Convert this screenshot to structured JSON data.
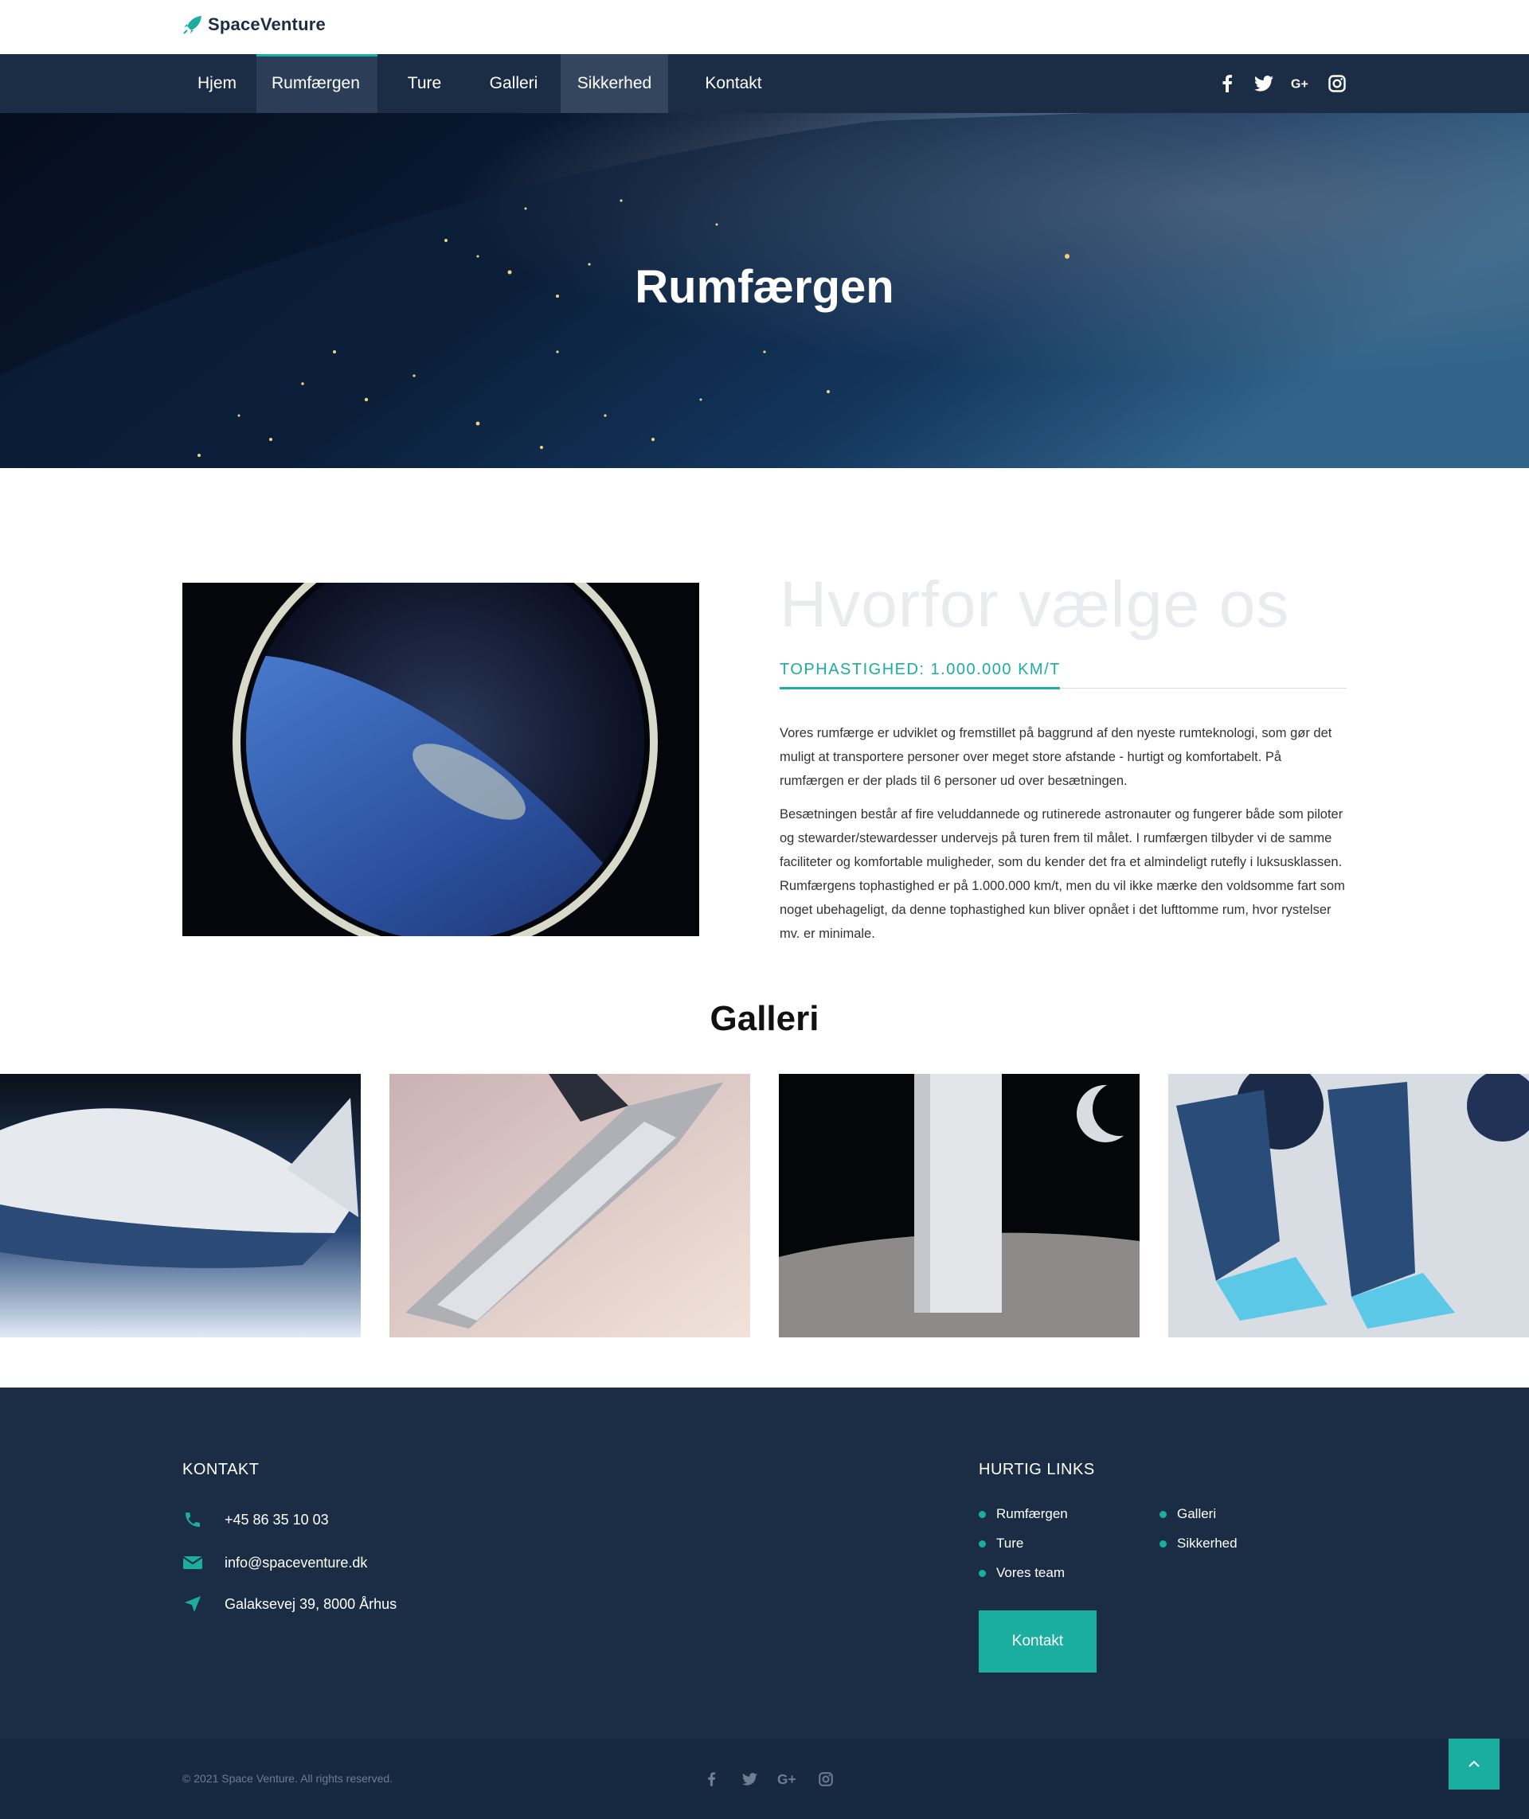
{
  "brand": {
    "name": "SpaceVenture"
  },
  "nav": {
    "items": [
      {
        "label": "Hjem"
      },
      {
        "label": "Rumfærgen"
      },
      {
        "label": "Ture"
      },
      {
        "label": "Galleri"
      },
      {
        "label": "Sikkerhed"
      },
      {
        "label": "Kontakt"
      }
    ],
    "active": "Rumfærgen",
    "social_icons": [
      "facebook-icon",
      "twitter-icon",
      "google-plus-icon",
      "instagram-icon"
    ]
  },
  "hero": {
    "title": "Rumfærgen"
  },
  "about": {
    "watermark": "Hvorfor vælge os",
    "speed_label": "TOPHASTIGHED: 1.000.000 KM/T",
    "paragraph1": "Vores rumfærge er udviklet og fremstillet på baggrund af den nyeste rumteknologi, som gør det muligt at transportere personer over meget store afstande - hurtigt og komfortabelt. På rumfærgen er der plads til 6 personer ud over besætningen.",
    "paragraph2": "Besætningen består af fire veluddannede og rutinerede astronauter og fungerer både som piloter og stewarder/stewardesser undervejs på turen frem til målet. I rumfærgen tilbyder vi de samme faciliteter og komfortable muligheder, som du kender det fra et almindeligt rutefly i luksusklassen. Rumfærgens tophastighed er på 1.000.000 km/t, men du vil ikke mærke den voldsomme fart som noget ubehageligt, da denne tophastighed kun bliver opnået i det lufttomme rum, hvor rystelser mv. er minimale."
  },
  "gallery": {
    "title": "Galleri"
  },
  "footer": {
    "contact_heading": "KONTAKT",
    "phone": "+45 86 35 10 03",
    "email": "info@spaceventure.dk",
    "address": "Galaksevej 39, 8000 Århus",
    "links_heading": "HURTIG LINKS",
    "links": [
      {
        "label": "Rumfærgen"
      },
      {
        "label": "Ture"
      },
      {
        "label": "Vores team"
      },
      {
        "label": "Galleri"
      },
      {
        "label": "Sikkerhed"
      }
    ],
    "button_label": "Kontakt",
    "copyright": "© 2021 Space Venture. All rights reserved."
  },
  "colors": {
    "navy": "#1b2c45",
    "teal": "#1aaea0"
  }
}
